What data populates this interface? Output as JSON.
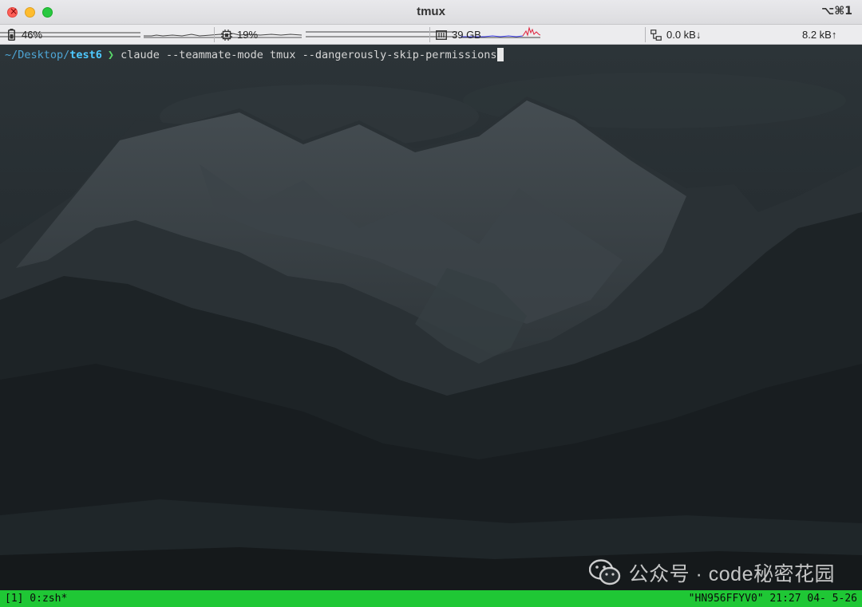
{
  "window": {
    "title": "tmux",
    "shortcut": "⌥⌘1"
  },
  "statusbar": {
    "battery": {
      "icon": "battery-icon",
      "value": "46%"
    },
    "cpu": {
      "icon": "cpu-icon",
      "value": "19%"
    },
    "memory": {
      "icon": "memory-icon",
      "value": "39 GB"
    },
    "network": {
      "icon": "network-icon",
      "down": "0.0 kB↓",
      "up": "8.2 kB↑"
    }
  },
  "terminal": {
    "path_prefix": "~/Desktop/",
    "path_leaf": "test6",
    "prompt_symbol": "❯",
    "command": "claude --teammate-mode tmux --dangerously-skip-permissions"
  },
  "watermark": {
    "text": "公众号 · code秘密花园",
    "icon": "wechat-icon"
  },
  "tmux": {
    "left": "[1] 0:zsh*",
    "right": "\"HN956FFYV0\" 21:27 04- 5-26"
  },
  "colors": {
    "tmux_bar": "#1fc735",
    "prompt_arrow": "#59d96a",
    "path": "#4ec9ff"
  }
}
